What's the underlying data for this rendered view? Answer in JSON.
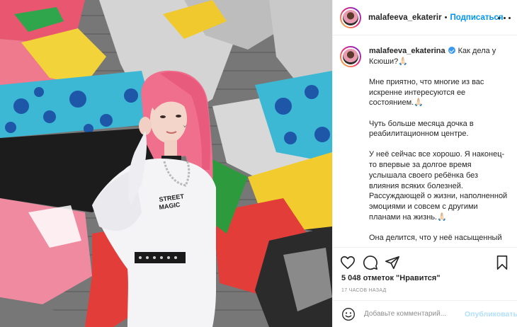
{
  "post": {
    "author": "malafeeva_ekaterir",
    "separator": "•",
    "follow_label": "Подписаться"
  },
  "caption": {
    "author": "malafeeva_ekaterina",
    "first_line": "Как дела у Ксюши?🙏🏻",
    "paragraphs": [
      "Мне приятно, что многие из вас искренне интересуются ее состоянием.🙏🏻",
      "Чуть больше месяца дочка в реабилитационном центре.",
      "У неё сейчас все хорошо. Я наконец-то впервые за долгое время услышала своего ребёнка без влияния всяких болезней. Рассуждающей о жизни, наполненной эмоциями и совсем с другими планами на жизнь.🙏🏻",
      "Она делится, что у неё насыщенный и интересные дни, что только к"
    ]
  },
  "actions": {
    "icons": [
      "heart-icon",
      "comment-icon",
      "share-icon",
      "bookmark-icon"
    ],
    "likes": "5 048 отметок \"Нравится\"",
    "time": "17 часов назад"
  },
  "comment_box": {
    "placeholder": "Добавьте комментарий...",
    "post_label": "Опубликовать"
  },
  "colors": {
    "accent": "#0095f6",
    "post_disabled": "#b2dffc",
    "muted": "#8e8e8e",
    "text": "#262626",
    "border": "#efefef"
  }
}
